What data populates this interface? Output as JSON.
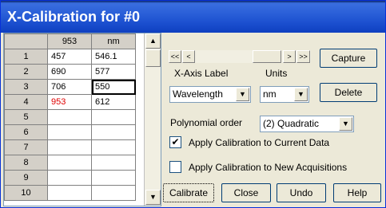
{
  "window": {
    "title": "X-Calibration for #0"
  },
  "grid": {
    "columns": [
      "953",
      "nm"
    ],
    "rows": [
      {
        "n": "1",
        "a": "457",
        "b": "546.1"
      },
      {
        "n": "2",
        "a": "690",
        "b": "577"
      },
      {
        "n": "3",
        "a": "706",
        "b": "550"
      },
      {
        "n": "4",
        "a": "953",
        "b": "612"
      },
      {
        "n": "5",
        "a": "",
        "b": ""
      },
      {
        "n": "6",
        "a": "",
        "b": ""
      },
      {
        "n": "7",
        "a": "",
        "b": ""
      },
      {
        "n": "8",
        "a": "",
        "b": ""
      },
      {
        "n": "9",
        "a": "",
        "b": ""
      },
      {
        "n": "10",
        "a": "",
        "b": ""
      }
    ]
  },
  "nav": {
    "first": "<<",
    "prev": "<",
    "next": ">",
    "last": ">>"
  },
  "buttons": {
    "capture": "Capture",
    "delete": "Delete",
    "calibrate": "Calibrate",
    "close": "Close",
    "undo": "Undo",
    "help": "Help"
  },
  "xaxis": {
    "label": "X-Axis Label",
    "value": "Wavelength"
  },
  "units": {
    "label": "Units",
    "value": "nm"
  },
  "poly": {
    "label": "Polynomial order",
    "value": "(2) Quadratic"
  },
  "checks": {
    "current": {
      "label": "Apply Calibration to Current Data",
      "checked": true
    },
    "new": {
      "label": "Apply Calibration to New Acquisitions",
      "checked": false
    }
  },
  "colors": {
    "title_bar": "#1b4fcf",
    "highlight_red": "#e00000"
  }
}
